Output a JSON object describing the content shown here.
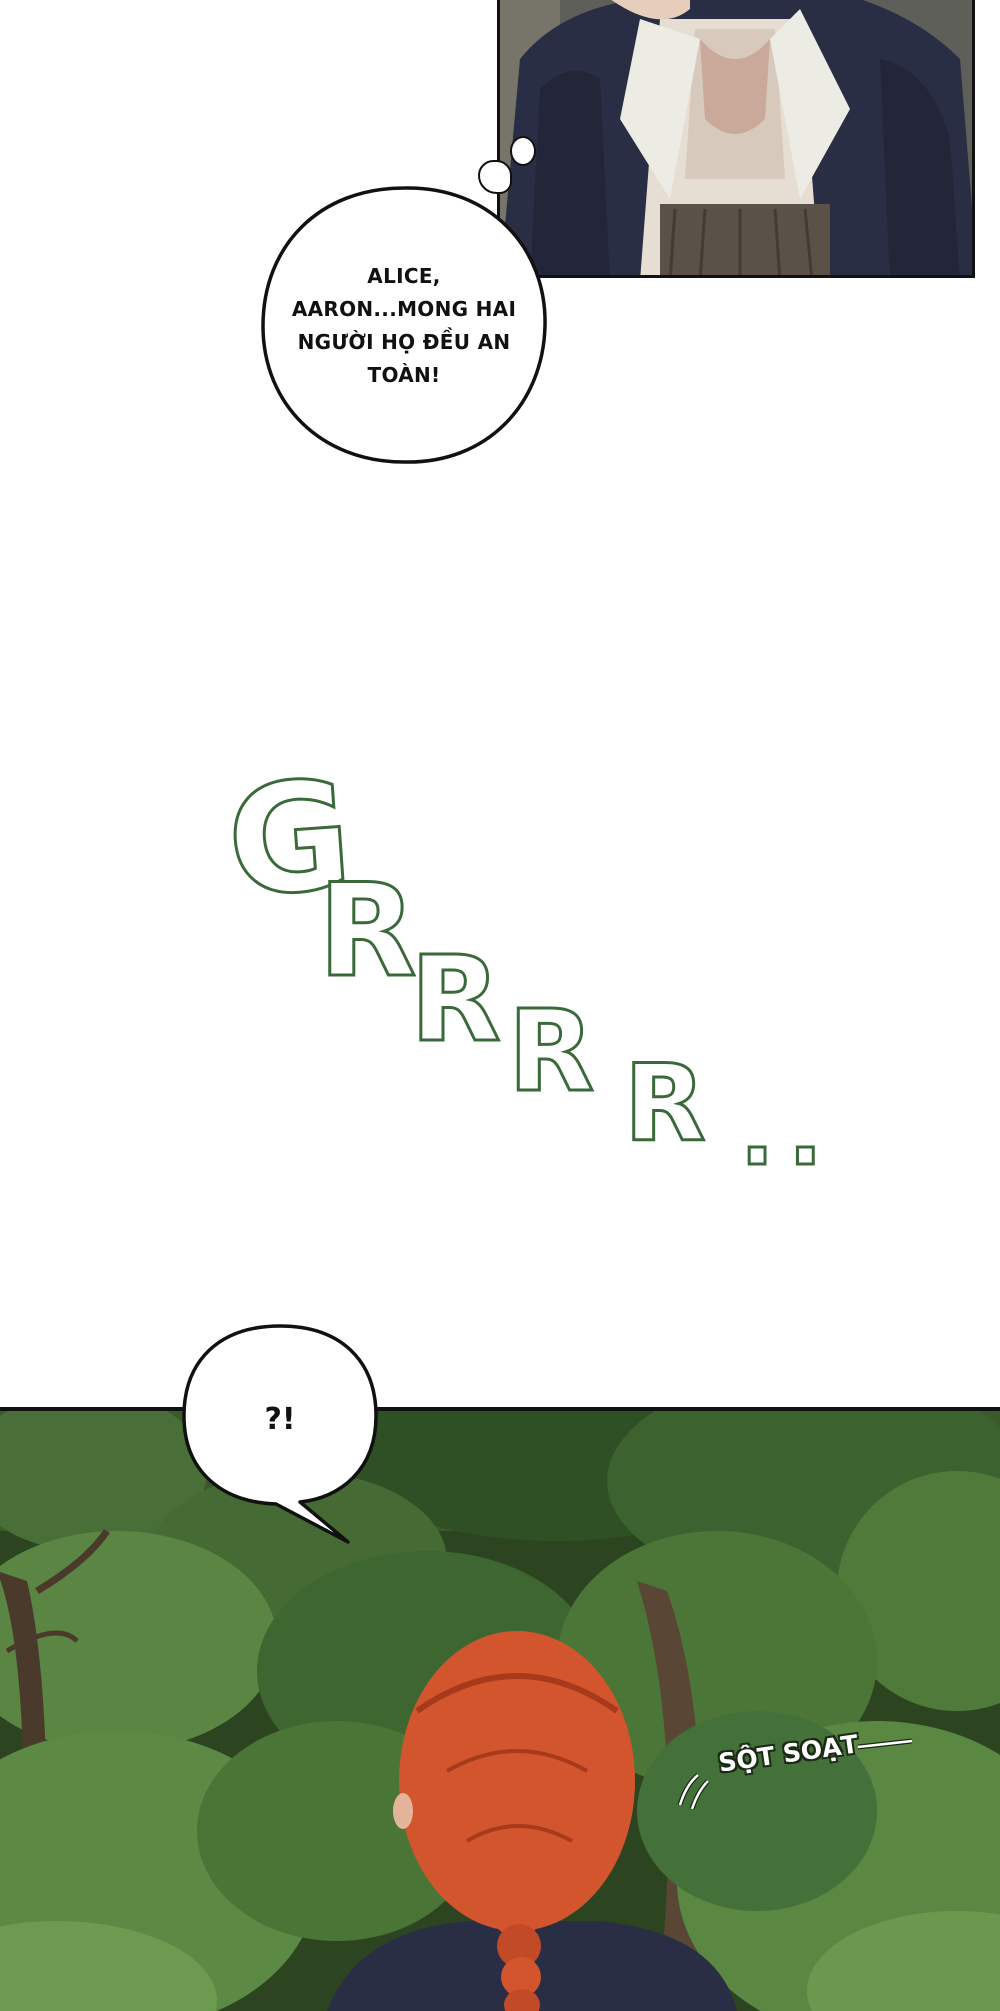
{
  "thought_bubble": {
    "line1": "ALICE,",
    "line2": "AARON...MONG HAI",
    "line3": "NGƯỜI HỌ ĐỀU AN",
    "line4": "TOÀN!"
  },
  "sfx": {
    "letters": [
      "G",
      "R",
      "R",
      "R",
      "R"
    ],
    "dots": "..",
    "color": "#3b6a3a"
  },
  "speech_bubble": {
    "text": "?!"
  },
  "rustle_sfx": {
    "text": "SỘT SOẠT"
  },
  "colors": {
    "hair": "#d2552e",
    "jacket": "#2a2e44",
    "foliage": "#3f6b2c"
  }
}
